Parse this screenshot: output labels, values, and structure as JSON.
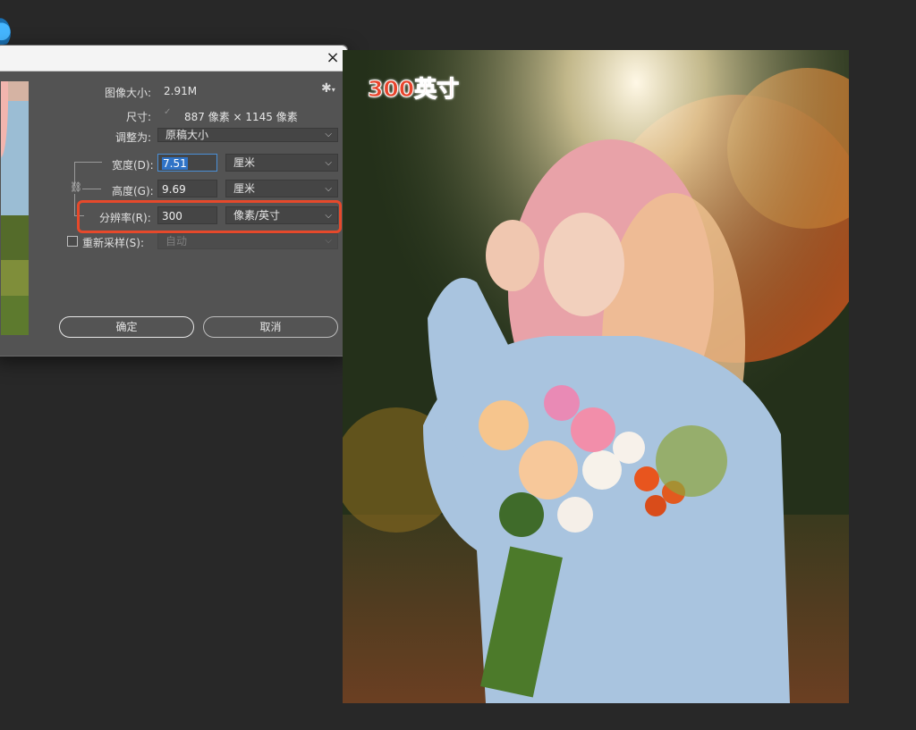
{
  "dialog": {
    "title": "",
    "close_glyph": "×",
    "image_size_label": "图像大小:",
    "image_size_value": "2.91M",
    "dimensions_label": "尺寸:",
    "dimensions_value": "887 像素 × 1145 像素",
    "fit_to_label": "调整为:",
    "fit_to_value": "原稿大小",
    "width_label": "宽度(D):",
    "width_value": "7.51",
    "width_unit": "厘米",
    "height_label": "高度(G):",
    "height_value": "9.69",
    "height_unit": "厘米",
    "resolution_label": "分辨率(R):",
    "resolution_value": "300",
    "resolution_unit": "像素/英寸",
    "resample_label": "重新采样(S):",
    "resample_value": "自动",
    "ok_button": "确定",
    "cancel_button": "取消"
  },
  "icons": {
    "settings": "gear-icon",
    "close": "close-icon",
    "chain": "link-icon",
    "dropdown": "chevron-down-icon"
  },
  "annotation": {
    "text": "300英寸"
  },
  "colors": {
    "highlight": "#e6492b",
    "dialog_bg": "#535353",
    "workspace_bg": "#282828",
    "selection": "#2f73c7"
  }
}
